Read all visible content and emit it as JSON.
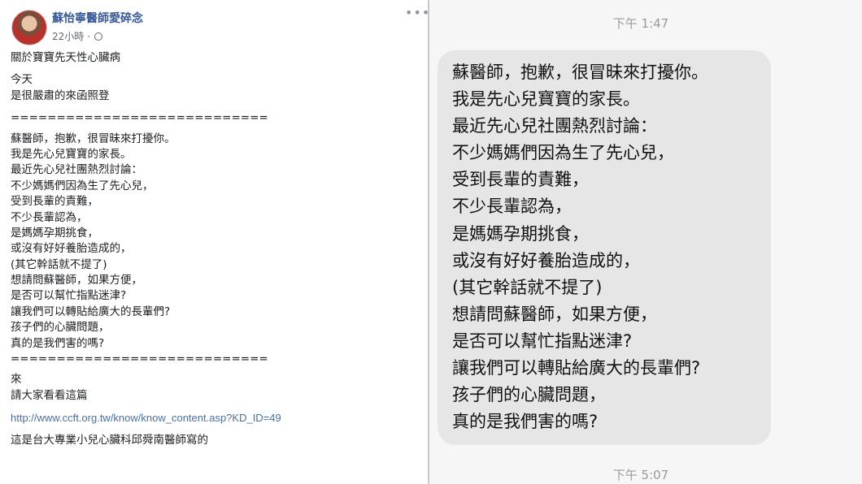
{
  "post": {
    "author": "蘇怡寧醫師愛碎念",
    "time": "22小時 ·",
    "more_label": "•••",
    "title": "關於寶寶先天性心臟病",
    "intro_lines": [
      "今天",
      "是很嚴肅的來函照登"
    ],
    "separator": "============================",
    "letter_lines": [
      "蘇醫師，抱歉，很冒昧來打擾你。",
      "我是先心兒寶寶的家長。",
      "最近先心兒社團熱烈討論：",
      "不少媽媽們因為生了先心兒，",
      "受到長輩的責難，",
      "不少長輩認為，",
      "是媽媽孕期挑食，",
      "或沒有好好養胎造成的，",
      "(其它幹話就不提了)",
      "想請問蘇醫師，如果方便，",
      "是否可以幫忙指點迷津?",
      "讓我們可以轉貼給廣大的長輩們?",
      "孩子們的心臟問題，",
      "真的是我們害的嗎?"
    ],
    "separator2": "============================",
    "outro_lines": [
      "來",
      "請大家看看這篇"
    ],
    "link": "http://www.ccft.org.tw/know/know_content.asp?KD_ID=49",
    "final_line": "這是台大專業小兒心臟科邱舜南醫師寫的"
  },
  "messages": {
    "time_top": "下午 1:47",
    "bubble_lines": [
      "蘇醫師，抱歉，很冒昧來打擾你。",
      "我是先心兒寶寶的家長。",
      "最近先心兒社團熱烈討論：",
      "不少媽媽們因為生了先心兒，",
      "受到長輩的責難，",
      "不少長輩認為，",
      "是媽媽孕期挑食，",
      "或沒有好好養胎造成的，",
      "(其它幹話就不提了)",
      "想請問蘇醫師，如果方便，",
      "是否可以幫忙指點迷津?",
      "讓我們可以轉貼給廣大的長輩們?",
      "孩子們的心臟問題，",
      "真的是我們害的嗎?"
    ],
    "time_bottom": "下午 5:07"
  }
}
